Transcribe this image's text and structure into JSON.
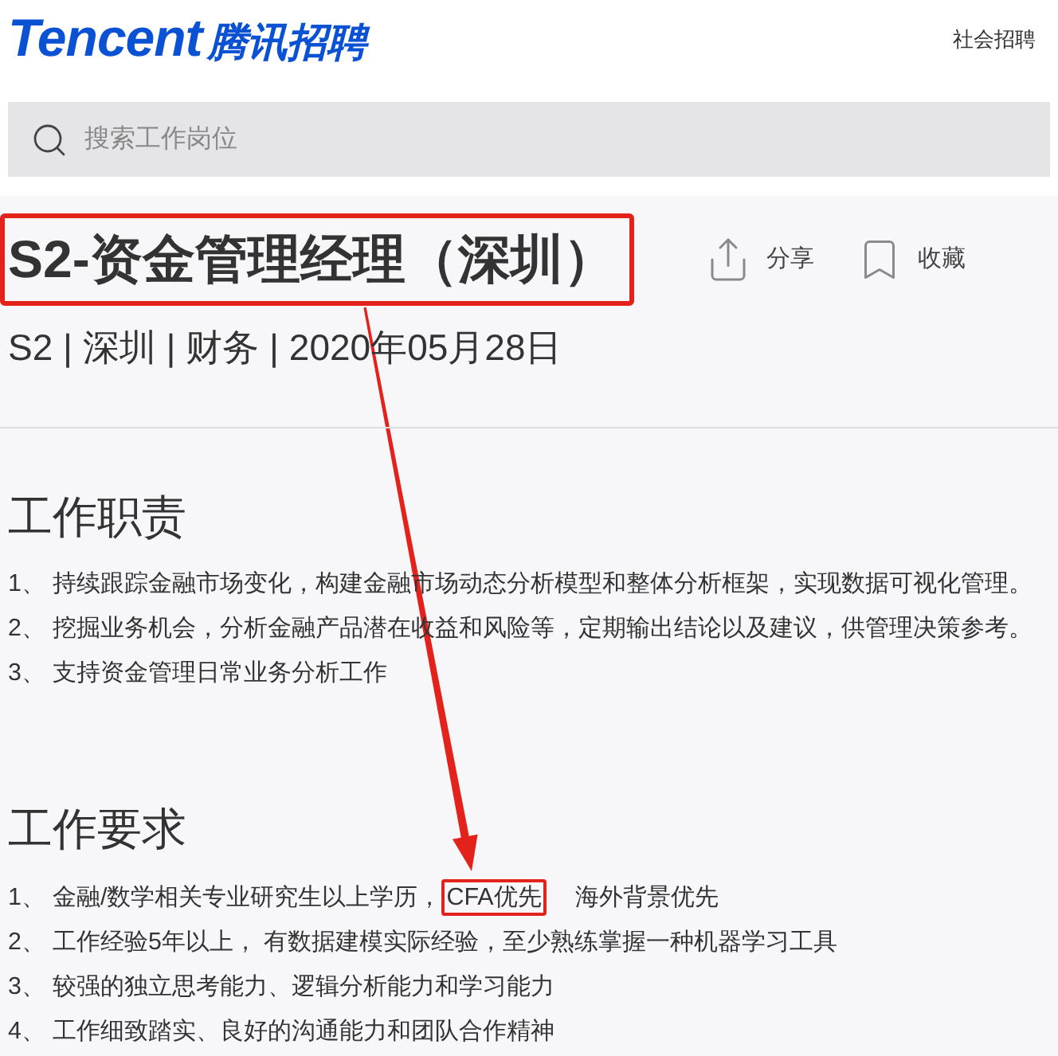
{
  "header": {
    "logo": {
      "wordmark": "Tencent",
      "title": "腾讯招聘"
    },
    "nav_link": "社会招聘"
  },
  "search": {
    "placeholder": "搜索工作岗位"
  },
  "job": {
    "title": "S2-资金管理经理（深圳）",
    "title_highlighted": true,
    "meta": "S2 | 深圳 | 财务 | 2020年05月28日",
    "actions": [
      {
        "kind": "share",
        "label": "分享"
      },
      {
        "kind": "bookmark",
        "label": "收藏"
      }
    ]
  },
  "sections": [
    {
      "heading": "工作职责",
      "items": [
        {
          "number": "1、",
          "text": "持续跟踪金融市场变化，构建金融市场动态分析模型和整体分析框架，实现数据可视化管理。"
        },
        {
          "number": "2、",
          "text": "挖掘业务机会，分析金融产品潜在收益和风险等，定期输出结论以及建议，供管理决策参考。"
        },
        {
          "number": "3、",
          "text": "支持资金管理日常业务分析工作"
        }
      ]
    },
    {
      "heading": "工作要求",
      "items": [
        {
          "number": "1、",
          "text": "金融/数学相关专业研究生以上学历，",
          "highlight": "CFA优先",
          "text_after": "海外背景优先"
        },
        {
          "number": "2、",
          "text": "工作经验5年以上， 有数据建模实际经验，至少熟练掌握一种机器学习工具"
        },
        {
          "number": "3、",
          "text": "较强的独立思考能力、逻辑分析能力和学习能力"
        },
        {
          "number": "4、",
          "text": "工作细致踏实、良好的沟通能力和团队合作精神"
        }
      ]
    }
  ]
}
